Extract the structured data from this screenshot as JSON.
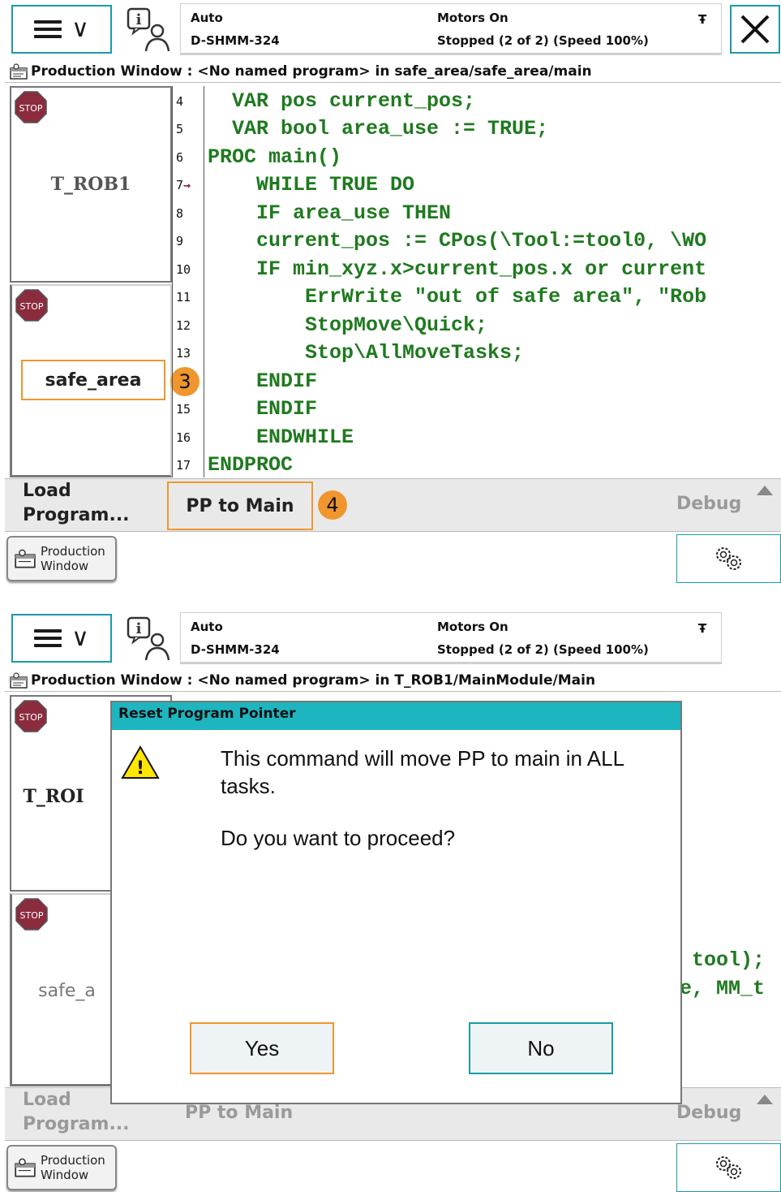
{
  "colors": {
    "accent": "#1a9aa8",
    "highlight": "#f0962e",
    "code_green": "#1f7a1f",
    "dialog_title": "#1db5bf"
  },
  "top": {
    "mode": "Auto",
    "controller": "D-SHMM-324",
    "motors": "Motors On",
    "state": "Stopped (2 of 2) (Speed 100%)"
  },
  "panel1": {
    "title": "Production Window : <No named program> in safe_area/safe_area/main",
    "tasks": [
      "T_ROB1",
      "safe_area"
    ],
    "line_numbers": [
      "4",
      "5",
      "6",
      "7",
      "8",
      "9",
      "10",
      "11",
      "12",
      "13",
      "",
      "15",
      "16",
      "17"
    ],
    "pp_line": "7",
    "code_lines": [
      "  VAR pos current_pos;",
      "  VAR bool area_use := TRUE;",
      "PROC main()",
      "    WHILE TRUE DO",
      "    IF area_use THEN",
      "    current_pos := CPos(\\Tool:=tool0, \\WO",
      "    IF min_xyz.x>current_pos.x or current",
      "        ErrWrite \"out of safe area\", \"Rob",
      "        StopMove\\Quick;",
      "        Stop\\AllMoveTasks;",
      "    ENDIF",
      "    ENDIF",
      "    ENDWHILE",
      "ENDPROC"
    ],
    "badges": [
      "3",
      "4"
    ],
    "commands": {
      "load": "Load Program...",
      "load_l1": "Load",
      "load_l2": "Program...",
      "pp_to_main": "PP to Main",
      "debug": "Debug"
    },
    "taskbar": {
      "prod_l1": "Production",
      "prod_l2": "Window"
    }
  },
  "panel2": {
    "title": "Production Window : <No named program> in T_ROB1/MainModule/Main",
    "tasks_partial": [
      "T_ROI",
      "safe_a"
    ],
    "code_partial": [
      " tool);",
      "e, MM_t"
    ],
    "commands": {
      "load_l1": "Load",
      "load_l2": "Program...",
      "pp_to_main": "PP to Main",
      "debug": "Debug"
    },
    "taskbar": {
      "prod_l1": "Production",
      "prod_l2": "Window"
    },
    "dialog": {
      "title": "Reset Program Pointer",
      "message": "This command will move PP to main in ALL tasks.",
      "question": "Do you want to proceed?",
      "yes": "Yes",
      "no": "No"
    }
  }
}
